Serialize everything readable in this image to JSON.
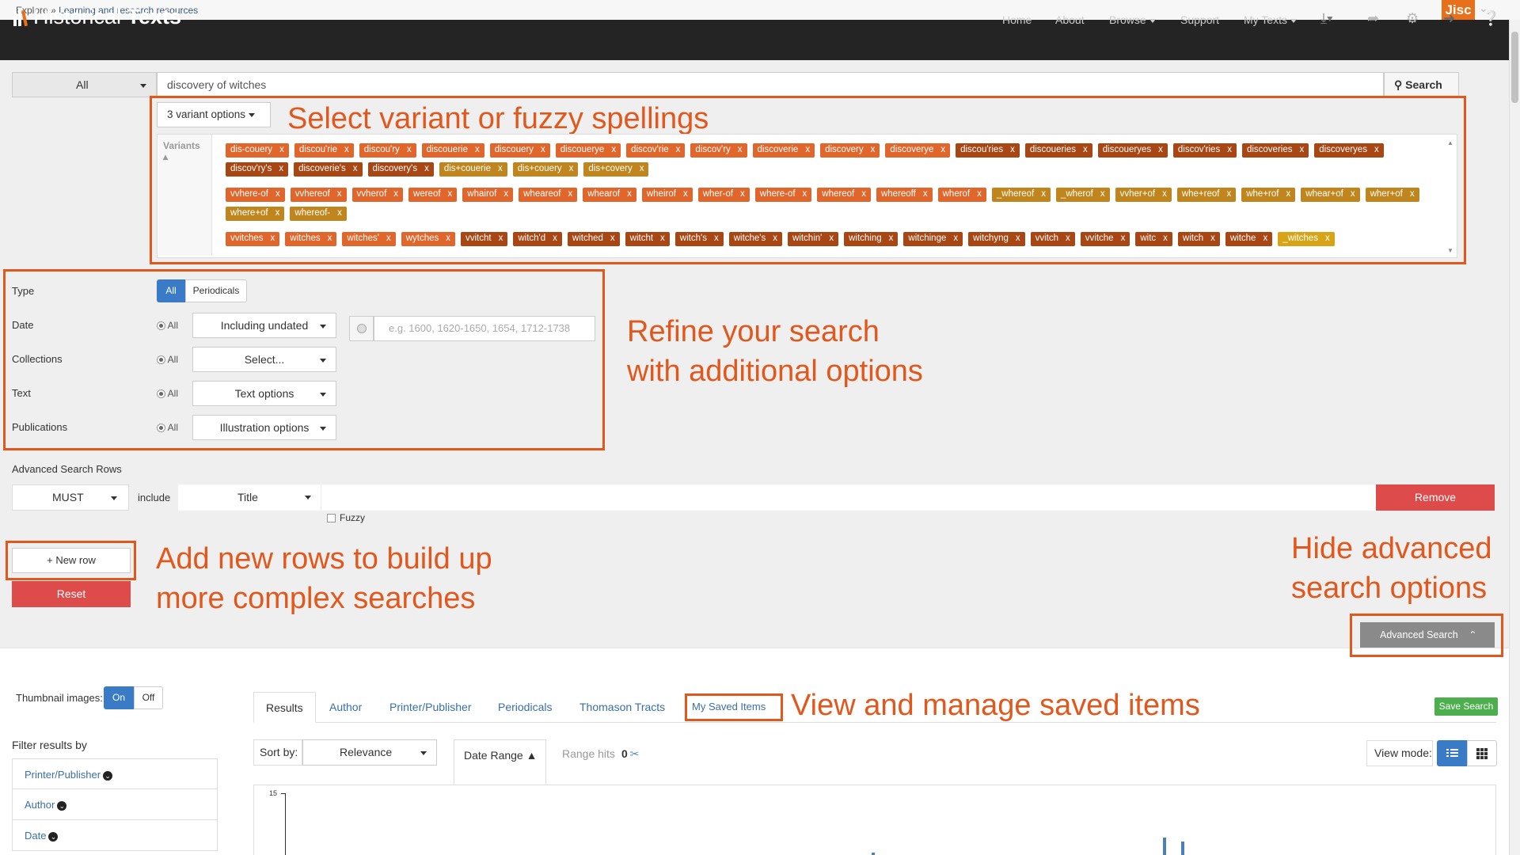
{
  "breadcrumb": {
    "explore": "Explore",
    "sep": "»",
    "current": "Learning and research resources"
  },
  "jisc": "Jisc",
  "brand": {
    "light": "Historical ",
    "bold": "Texts"
  },
  "nav": [
    "Home",
    "About",
    "Browse",
    "Support",
    "My Texts"
  ],
  "search": {
    "scope": "All",
    "query": "discovery of witches",
    "button": "Search"
  },
  "variants": {
    "button": "3 variant options",
    "label": "Variants",
    "groups": [
      [
        [
          "dis-couery",
          "c0"
        ],
        [
          "discou'rie",
          "c0"
        ],
        [
          "discou'ry",
          "c0"
        ],
        [
          "discouerie",
          "c0"
        ],
        [
          "discouery",
          "c0"
        ],
        [
          "discouerye",
          "c0"
        ],
        [
          "discov'rie",
          "c0"
        ],
        [
          "discov'ry",
          "c0"
        ],
        [
          "discoverie",
          "c0"
        ],
        [
          "discovery",
          "c0"
        ],
        [
          "discoverye",
          "c0"
        ],
        [
          "discou'ries",
          "c2"
        ],
        [
          "discoueries",
          "c2"
        ],
        [
          "discoueryes",
          "c2"
        ],
        [
          "discov'ries",
          "c2"
        ],
        [
          "discoveries",
          "c2"
        ],
        [
          "discoveryes",
          "c2"
        ],
        [
          "discov'ry's",
          "c2"
        ],
        [
          "discoverie's",
          "c2"
        ],
        [
          "discovery's",
          "c2"
        ],
        [
          "dis+couerie",
          "c3"
        ],
        [
          "dis+couery",
          "c3"
        ],
        [
          "dis+covery",
          "c3"
        ]
      ],
      [
        [
          "vvhere-of",
          "c0"
        ],
        [
          "vvhereof",
          "c0"
        ],
        [
          "vvherof",
          "c0"
        ],
        [
          "wereof",
          "c0"
        ],
        [
          "whairof",
          "c0"
        ],
        [
          "wheareof",
          "c0"
        ],
        [
          "whearof",
          "c0"
        ],
        [
          "wheirof",
          "c0"
        ],
        [
          "wher-of",
          "c0"
        ],
        [
          "where-of",
          "c0"
        ],
        [
          "whereof",
          "c0"
        ],
        [
          "whereoff",
          "c0"
        ],
        [
          "wherof",
          "c0"
        ],
        [
          "_whereof",
          "c3"
        ],
        [
          "_wherof",
          "c3"
        ],
        [
          "vvher+of",
          "c3"
        ],
        [
          "whe+reof",
          "c3"
        ],
        [
          "whe+rof",
          "c3"
        ],
        [
          "whear+of",
          "c3"
        ],
        [
          "wher+of",
          "c3"
        ],
        [
          "where+of",
          "c3"
        ],
        [
          "whereof-",
          "c3"
        ]
      ],
      [
        [
          "vvitches",
          "c0"
        ],
        [
          "witches",
          "c0"
        ],
        [
          "witches'",
          "c0"
        ],
        [
          "wytches",
          "c0"
        ],
        [
          "vvitcht",
          "c2"
        ],
        [
          "witch'd",
          "c2"
        ],
        [
          "witched",
          "c2"
        ],
        [
          "witcht",
          "c2"
        ],
        [
          "witch's",
          "c2"
        ],
        [
          "witche's",
          "c2"
        ],
        [
          "witchin'",
          "c2"
        ],
        [
          "witching",
          "c2"
        ],
        [
          "witchinge",
          "c2"
        ],
        [
          "witchyng",
          "c2"
        ],
        [
          "vvitch",
          "c2"
        ],
        [
          "vvitche",
          "c2"
        ],
        [
          "witc",
          "c2"
        ],
        [
          "witch",
          "c2"
        ],
        [
          "witche",
          "c2"
        ],
        [
          "_witches",
          "c4"
        ]
      ]
    ]
  },
  "annotations": {
    "variants": "Select variant or fuzzy spellings",
    "refine1": "Refine your search",
    "refine2": "with additional options",
    "rows1": "Add new rows to build up",
    "rows2": "more complex searches",
    "hide1": "Hide advanced",
    "hide2": "search options",
    "saved": "View and manage saved items"
  },
  "filters": {
    "type": {
      "label": "Type",
      "all": "All",
      "periodicals": "Periodicals"
    },
    "date": {
      "label": "Date",
      "all": "All",
      "select": "Including undated",
      "placeholder": "e.g. 1600, 1620-1650, 1654, 1712-1738"
    },
    "collections": {
      "label": "Collections",
      "all": "All",
      "select": "Select..."
    },
    "text": {
      "label": "Text",
      "all": "All",
      "select": "Text options"
    },
    "publications": {
      "label": "Publications",
      "all": "All",
      "select": "Illustration options"
    }
  },
  "advanced": {
    "label": "Advanced Search Rows",
    "must": "MUST",
    "include": "include",
    "field": "Title",
    "remove": "Remove",
    "fuzzy": "Fuzzy",
    "new_row": "+ New row",
    "reset": "Reset",
    "toggle": "Advanced Search"
  },
  "results": {
    "thumb_label": "Thumbnail images:",
    "on": "On",
    "off": "Off",
    "tabs": [
      "Results",
      "Author",
      "Printer/Publisher",
      "Periodicals",
      "Thomason Tracts",
      "My Saved Items"
    ],
    "save_search": "Save Search",
    "filter_label": "Filter results by",
    "facets": [
      "Printer/Publisher",
      "Author",
      "Date"
    ],
    "sort_label": "Sort by:",
    "sort": "Relevance",
    "date_range": "Date Range",
    "range_hits": "Range hits",
    "range_hits_value": "0",
    "view_mode": "View mode:"
  },
  "chart_data": {
    "type": "bar",
    "y_tick": "15",
    "ylim": [
      0,
      15
    ],
    "bars": [
      {
        "x_frac": 0.484,
        "value": 0.5
      },
      {
        "x_frac": 0.725,
        "value": 4.2
      },
      {
        "x_frac": 0.74,
        "value": 3.3
      }
    ]
  },
  "colors": {
    "accent": "#e2571b",
    "primary": "#3a7bc8",
    "danger": "#de4b4b",
    "success": "#4cae4c",
    "navbar": "#242424"
  }
}
